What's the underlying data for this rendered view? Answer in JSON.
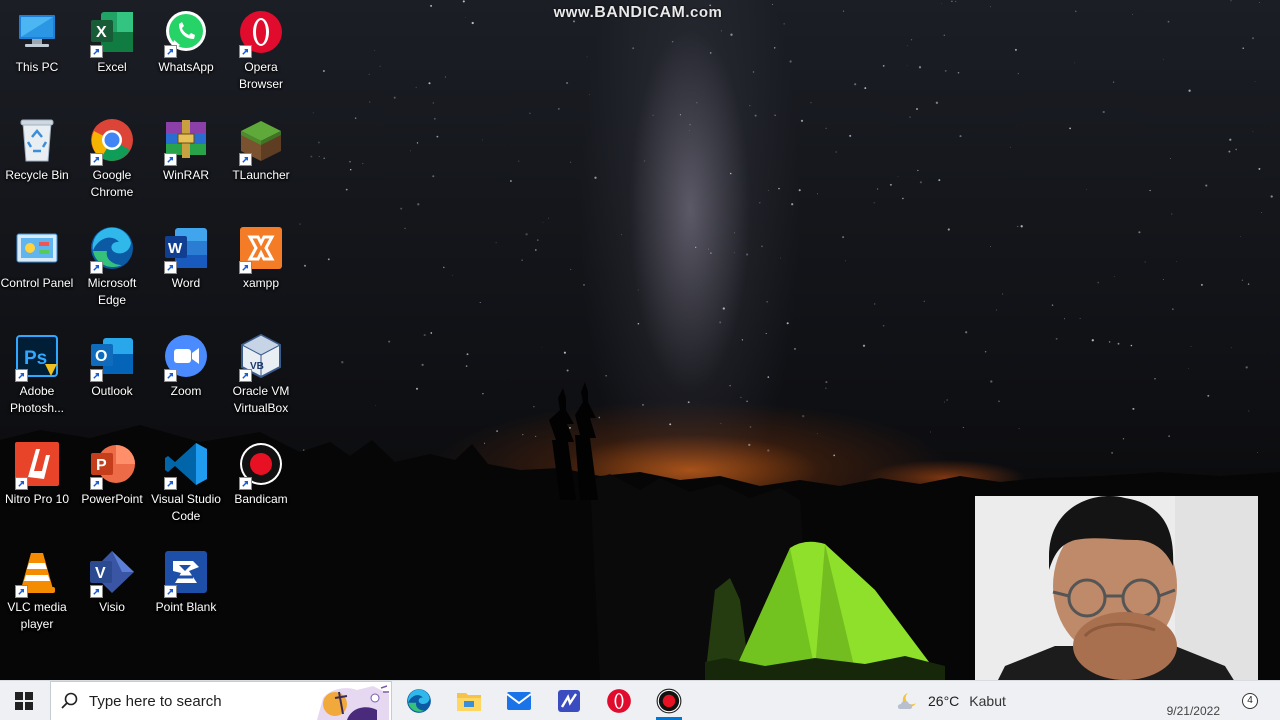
{
  "watermark": {
    "prefix": "www.",
    "brand": "BANDICAM",
    "suffix": ".com"
  },
  "desktop": {
    "icons": [
      {
        "label": "This PC",
        "icon": "this-pc-icon",
        "shortcut": false
      },
      {
        "label": "Excel",
        "icon": "excel-icon",
        "shortcut": true
      },
      {
        "label": "WhatsApp",
        "icon": "whatsapp-icon",
        "shortcut": true
      },
      {
        "label": "Opera Browser",
        "icon": "opera-icon",
        "shortcut": true
      },
      {
        "label": "Recycle Bin",
        "icon": "recycle-bin-icon",
        "shortcut": false
      },
      {
        "label": "Google Chrome",
        "icon": "chrome-icon",
        "shortcut": true
      },
      {
        "label": "WinRAR",
        "icon": "winrar-icon",
        "shortcut": true
      },
      {
        "label": "TLauncher",
        "icon": "tlauncher-icon",
        "shortcut": true
      },
      {
        "label": "Control Panel",
        "icon": "control-panel-icon",
        "shortcut": false
      },
      {
        "label": "Microsoft Edge",
        "icon": "edge-icon",
        "shortcut": true
      },
      {
        "label": "Word",
        "icon": "word-icon",
        "shortcut": true
      },
      {
        "label": "xampp",
        "icon": "xampp-icon",
        "shortcut": true
      },
      {
        "label": "Adobe Photosh...",
        "icon": "photoshop-icon",
        "shortcut": true
      },
      {
        "label": "Outlook",
        "icon": "outlook-icon",
        "shortcut": true
      },
      {
        "label": "Zoom",
        "icon": "zoom-icon",
        "shortcut": true
      },
      {
        "label": "Oracle VM VirtualBox",
        "icon": "virtualbox-icon",
        "shortcut": true
      },
      {
        "label": "Nitro Pro 10",
        "icon": "nitro-pro-icon",
        "shortcut": true
      },
      {
        "label": "PowerPoint",
        "icon": "powerpoint-icon",
        "shortcut": true
      },
      {
        "label": "Visual Studio Code",
        "icon": "vscode-icon",
        "shortcut": true
      },
      {
        "label": "Bandicam",
        "icon": "bandicam-icon",
        "shortcut": true
      },
      {
        "label": "VLC media player",
        "icon": "vlc-icon",
        "shortcut": true
      },
      {
        "label": "Visio",
        "icon": "visio-icon",
        "shortcut": true
      },
      {
        "label": "Point Blank",
        "icon": "point-blank-icon",
        "shortcut": true
      }
    ]
  },
  "taskbar": {
    "search_placeholder": "Type here to search",
    "apps": [
      {
        "name": "Microsoft Edge",
        "icon": "edge-icon"
      },
      {
        "name": "File Explorer",
        "icon": "file-explorer-icon"
      },
      {
        "name": "Mail",
        "icon": "mail-icon"
      },
      {
        "name": "Microsoft Whiteboard",
        "icon": "whiteboard-icon"
      },
      {
        "name": "Opera",
        "icon": "opera-icon"
      },
      {
        "name": "Bandicam",
        "icon": "bandicam-icon"
      }
    ],
    "weather": {
      "temperature": "26°C",
      "condition_partial": "Kabut",
      "icon": "weather-cloudy-night-icon"
    },
    "clock": {
      "date": "9/21/2022"
    },
    "notifications_count": "4"
  },
  "colors": {
    "taskbar_bg": "#eef0f4",
    "accent": "#0078d4",
    "icon_label": "#ffffff"
  }
}
